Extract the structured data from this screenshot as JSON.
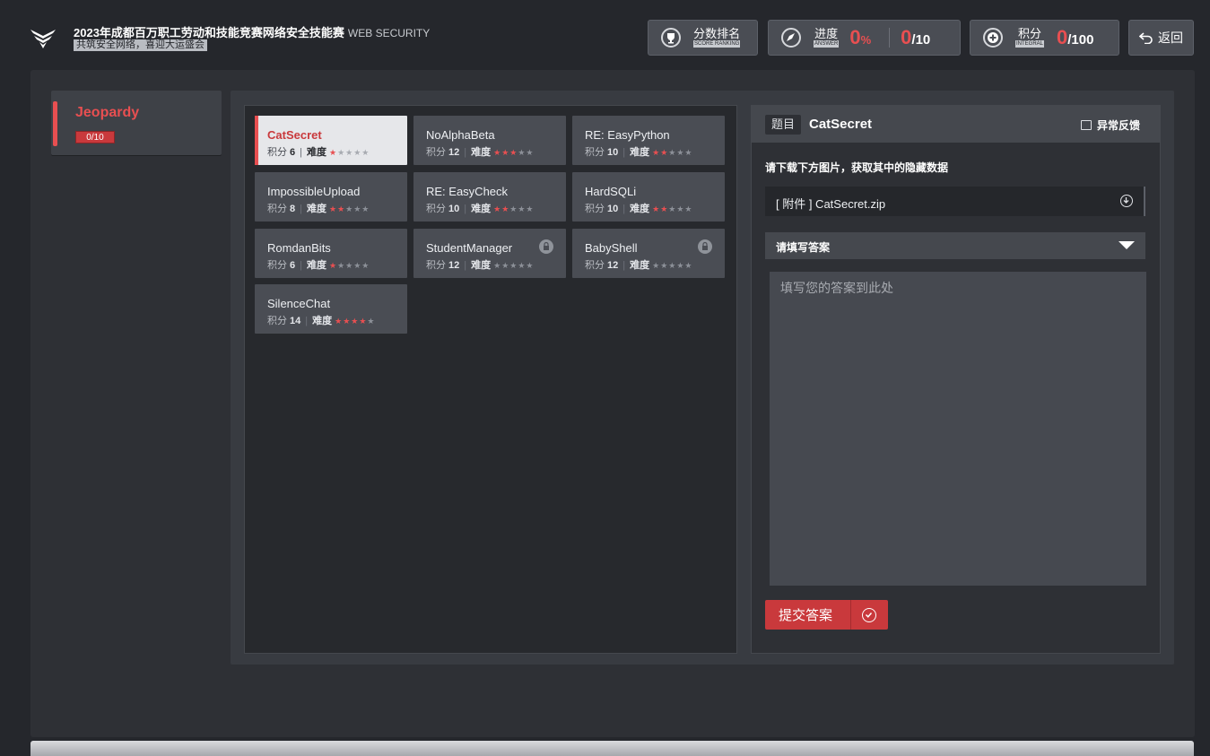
{
  "header": {
    "title": "2023年成都百万职工劳动和技能竞赛网络安全技能赛",
    "title_en": "WEB SECURITY",
    "subtitle": "共筑安全网络，喜迎大运盛会",
    "ranking": {
      "label": "分数排名",
      "label_en": "SCORE RANKING"
    },
    "progress": {
      "label": "进度",
      "label_en": "ANSWER",
      "percent": "0",
      "percent_unit": "%",
      "done": "0",
      "total": "/10"
    },
    "points": {
      "label": "积分",
      "label_en": "INTEGRAL",
      "value": "0",
      "total": "/100"
    },
    "back_label": "返回"
  },
  "category": {
    "name": "Jeopardy",
    "progress": "0/10"
  },
  "challenges": [
    {
      "name": "CatSecret",
      "points_label": "积分",
      "points": "6",
      "diff_label": "难度",
      "stars": 1,
      "active": true,
      "locked": false
    },
    {
      "name": "NoAlphaBeta",
      "points_label": "积分",
      "points": "12",
      "diff_label": "难度",
      "stars": 3,
      "active": false,
      "locked": false
    },
    {
      "name": "RE: EasyPython",
      "points_label": "积分",
      "points": "10",
      "diff_label": "难度",
      "stars": 2,
      "active": false,
      "locked": false
    },
    {
      "name": "ImpossibleUpload",
      "points_label": "积分",
      "points": "8",
      "diff_label": "难度",
      "stars": 2,
      "active": false,
      "locked": false
    },
    {
      "name": "RE: EasyCheck",
      "points_label": "积分",
      "points": "10",
      "diff_label": "难度",
      "stars": 2,
      "active": false,
      "locked": false
    },
    {
      "name": "HardSQLi",
      "points_label": "积分",
      "points": "10",
      "diff_label": "难度",
      "stars": 2,
      "active": false,
      "locked": false
    },
    {
      "name": "RomdanBits",
      "points_label": "积分",
      "points": "6",
      "diff_label": "难度",
      "stars": 1,
      "active": false,
      "locked": false
    },
    {
      "name": "StudentManager",
      "points_label": "积分",
      "points": "12",
      "diff_label": "难度",
      "stars": 0,
      "active": false,
      "locked": true
    },
    {
      "name": "BabyShell",
      "points_label": "积分",
      "points": "12",
      "diff_label": "难度",
      "stars": 0,
      "active": false,
      "locked": true
    },
    {
      "name": "SilenceChat",
      "points_label": "积分",
      "points": "14",
      "diff_label": "难度",
      "stars": 4,
      "active": false,
      "locked": false
    }
  ],
  "detail": {
    "tag": "题目",
    "title": "CatSecret",
    "feedback": "异常反馈",
    "description": "请下载下方图片，获取其中的隐藏数据",
    "attachment": "[ 附件 ] CatSecret.zip",
    "answer_header": "请填写答案",
    "answer_placeholder": "填写您的答案到此处",
    "submit_label": "提交答案"
  },
  "colors": {
    "accent": "#e84f51",
    "panel": "#4a4d54",
    "background": "#25272c"
  }
}
